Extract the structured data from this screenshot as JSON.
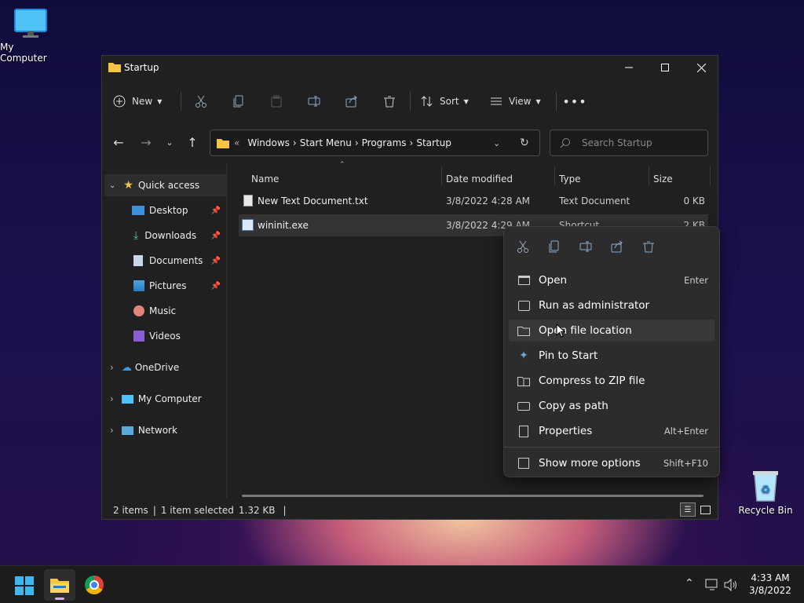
{
  "desktop": {
    "my_computer": "My Computer",
    "recycle_bin": "Recycle Bin"
  },
  "window": {
    "title": "Startup"
  },
  "toolbar": {
    "new": "New",
    "sort": "Sort",
    "view": "View"
  },
  "address": {
    "prefix": "«",
    "crumbs": [
      "Windows",
      "Start Menu",
      "Programs",
      "Startup"
    ]
  },
  "search": {
    "placeholder": "Search Startup"
  },
  "nav": {
    "quick_access": "Quick access",
    "desktop": "Desktop",
    "downloads": "Downloads",
    "documents": "Documents",
    "pictures": "Pictures",
    "music": "Music",
    "videos": "Videos",
    "onedrive": "OneDrive",
    "my_computer": "My Computer",
    "network": "Network"
  },
  "columns": {
    "name": "Name",
    "date": "Date modified",
    "type": "Type",
    "size": "Size"
  },
  "files": [
    {
      "name": "New Text Document.txt",
      "date": "3/8/2022 4:28 AM",
      "type": "Text Document",
      "size": "0 KB"
    },
    {
      "name": "wininit.exe",
      "date": "3/8/2022 4:29 AM",
      "type": "Shortcut",
      "size": "2 KB"
    }
  ],
  "status": {
    "items": "2 items",
    "selected": "1 item selected",
    "size": "1.32 KB",
    "divider": "|"
  },
  "context_menu": {
    "open": "Open",
    "open_sc": "Enter",
    "run_admin": "Run as administrator",
    "open_location": "Open file location",
    "pin_start": "Pin to Start",
    "compress": "Compress to ZIP file",
    "copy_path": "Copy as path",
    "properties": "Properties",
    "properties_sc": "Alt+Enter",
    "more": "Show more options",
    "more_sc": "Shift+F10"
  },
  "clock": {
    "time": "4:33 AM",
    "date": "3/8/2022"
  }
}
